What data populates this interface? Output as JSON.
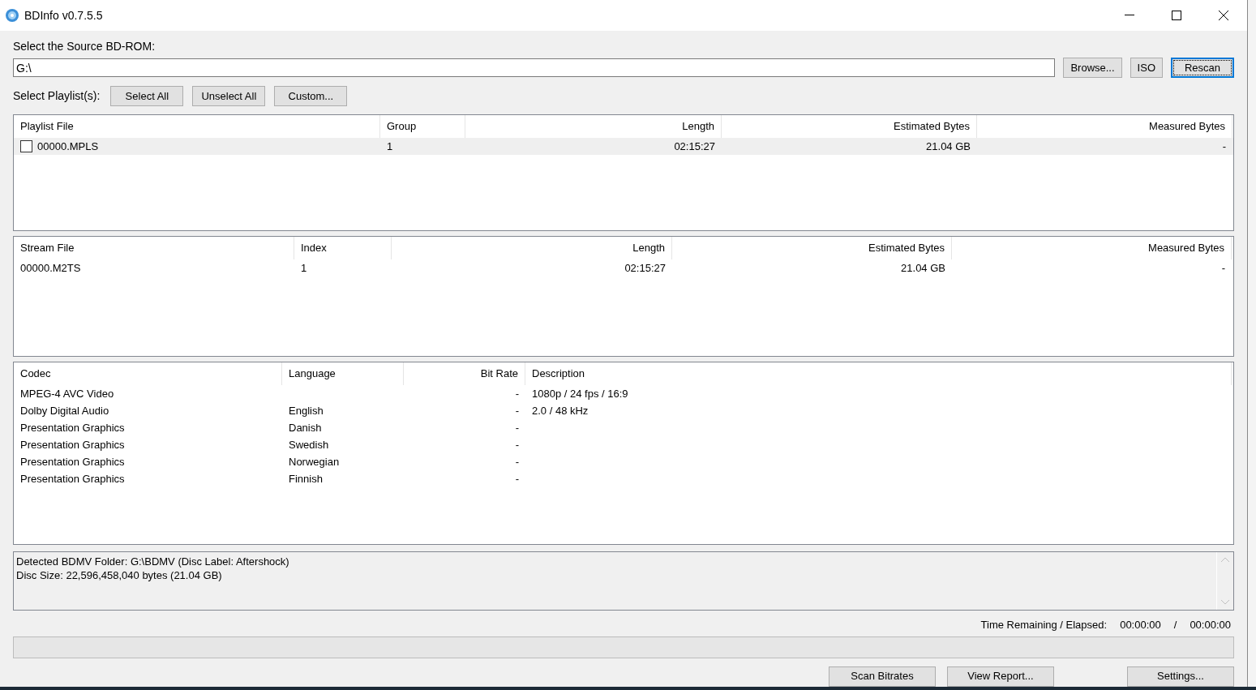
{
  "window": {
    "title": "BDInfo v0.7.5.5"
  },
  "source": {
    "label": "Select the Source BD-ROM:",
    "value": "G:\\",
    "buttons": [
      {
        "label": "Browse...",
        "focused": false
      },
      {
        "label": "ISO",
        "focused": false
      },
      {
        "label": "Rescan",
        "focused": true
      }
    ]
  },
  "playlist_select": {
    "label": "Select Playlist(s):",
    "buttons": [
      "Select All",
      "Unselect All",
      "Custom..."
    ]
  },
  "playlists": {
    "columns": [
      "Playlist File",
      "Group",
      "Length",
      "Estimated Bytes",
      "Measured Bytes"
    ],
    "rows": [
      {
        "checked": false,
        "highlighted": true,
        "cells": [
          "00000.MPLS",
          "1",
          "02:15:27",
          "21.04 GB",
          "-"
        ]
      }
    ]
  },
  "streams": {
    "columns": [
      "Stream File",
      "Index",
      "Length",
      "Estimated Bytes",
      "Measured Bytes"
    ],
    "rows": [
      {
        "cells": [
          "00000.M2TS",
          "1",
          "02:15:27",
          "21.04 GB",
          "-"
        ]
      }
    ]
  },
  "codecs": {
    "columns": [
      "Codec",
      "Language",
      "Bit Rate",
      "Description"
    ],
    "rows": [
      {
        "cells": [
          "MPEG-4 AVC Video",
          "",
          "-",
          "1080p / 24 fps / 16:9"
        ]
      },
      {
        "cells": [
          "Dolby Digital Audio",
          "English",
          "-",
          "2.0 / 48 kHz"
        ]
      },
      {
        "cells": [
          "Presentation Graphics",
          "Danish",
          "-",
          ""
        ]
      },
      {
        "cells": [
          "Presentation Graphics",
          "Swedish",
          "-",
          ""
        ]
      },
      {
        "cells": [
          "Presentation Graphics",
          "Norwegian",
          "-",
          ""
        ]
      },
      {
        "cells": [
          "Presentation Graphics",
          "Finnish",
          "-",
          ""
        ]
      }
    ]
  },
  "log": [
    "Detected BDMV Folder: G:\\BDMV (Disc Label: Aftershock)",
    "Disc Size: 22,596,458,040 bytes (21.04 GB)"
  ],
  "time": {
    "label": "Time Remaining / Elapsed:",
    "remaining": "00:00:00",
    "separator": "/",
    "elapsed": "00:00:00"
  },
  "progress": {
    "level": 0
  },
  "bottom_buttons": [
    "Scan Bitrates",
    "View Report...",
    "Settings..."
  ]
}
